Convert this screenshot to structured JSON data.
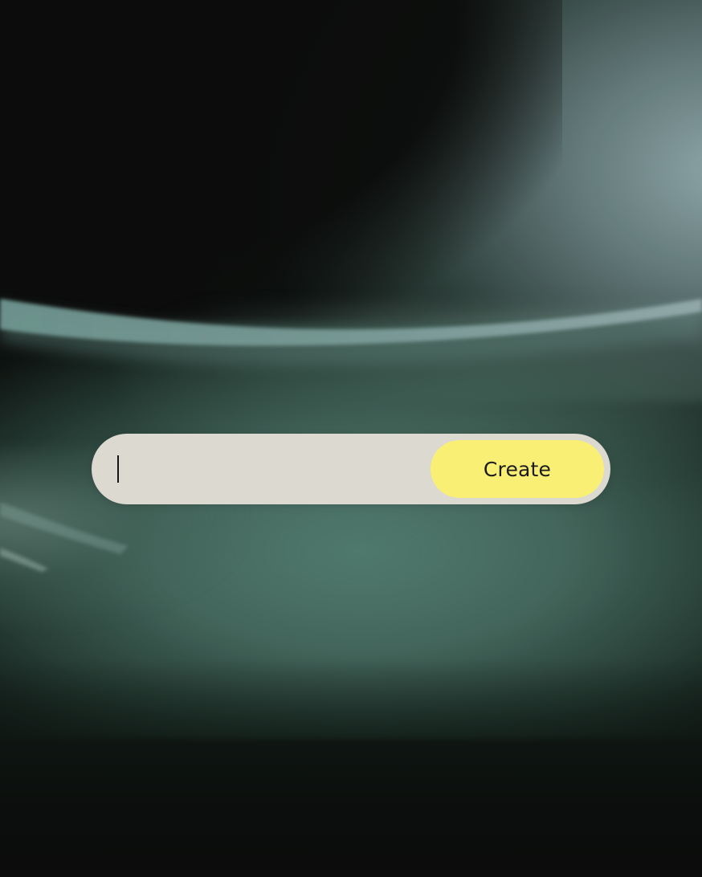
{
  "prompt": {
    "input_value": "",
    "input_placeholder": "",
    "create_label": "Create"
  },
  "colors": {
    "bar_background": "#dcd9d1",
    "button_background": "#f8ef74",
    "button_text": "#1b1b1b",
    "page_background": "#0b0c0b"
  }
}
